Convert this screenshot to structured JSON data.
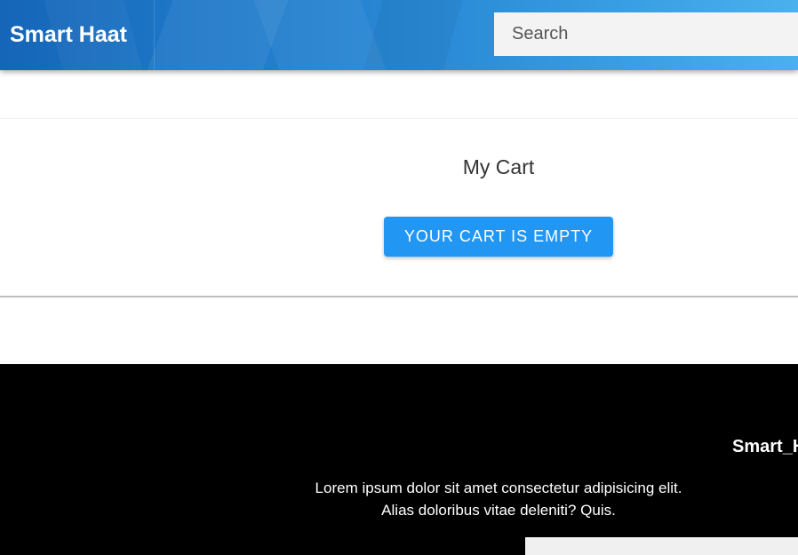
{
  "header": {
    "brand": "Smart Haat",
    "search_placeholder": "Search"
  },
  "cart": {
    "title": "My Cart",
    "empty_label": "Your cart is empty"
  },
  "footer": {
    "brand": "Smart_H",
    "text_line1": "Lorem ipsum dolor sit amet consectetur adipisicing elit.",
    "text_line2": "Alias doloribus vitae deleniti? Quis."
  },
  "colors": {
    "header_accent": "#1e78c8",
    "button": "#2196f3",
    "footer_bg": "#000000"
  }
}
